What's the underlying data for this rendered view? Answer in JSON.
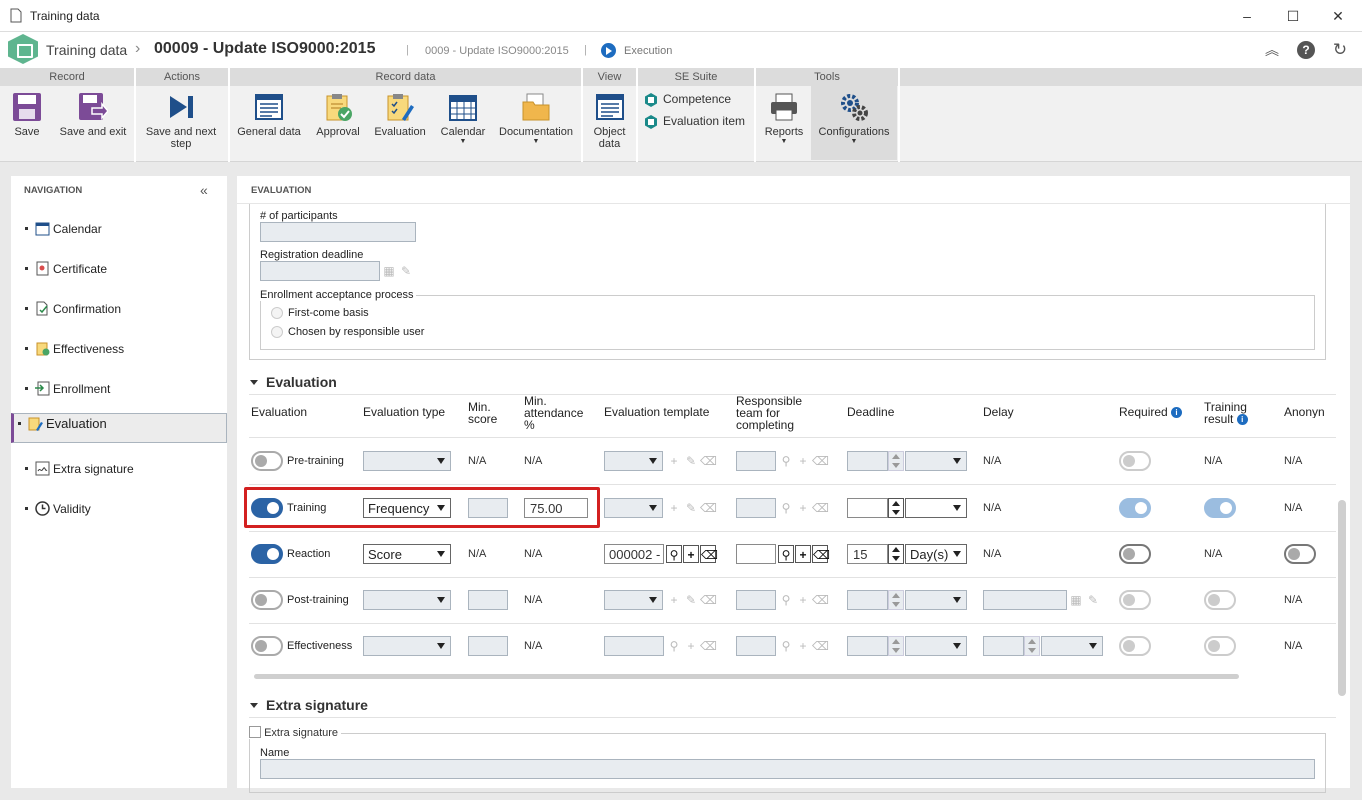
{
  "window": {
    "title": "Training data"
  },
  "header": {
    "breadcrumb_root": "Training data",
    "record_title": "00009 - Update ISO9000:2015",
    "record_subtitle": "0009 - Update ISO9000:2015",
    "status": "Execution"
  },
  "ribbon": {
    "groups": [
      "Record",
      "Actions",
      "Record data",
      "View",
      "SE Suite",
      "Tools"
    ],
    "buttons": {
      "save": "Save",
      "save_exit": "Save and exit",
      "save_next": "Save and next step",
      "general_data": "General data",
      "approval": "Approval",
      "evaluation": "Evaluation",
      "calendar": "Calendar",
      "documentation": "Documentation",
      "object_data": "Object data",
      "competence": "Competence",
      "evaluation_item": "Evaluation item",
      "reports": "Reports",
      "configurations": "Configurations"
    }
  },
  "navigation": {
    "title": "NAVIGATION",
    "items": [
      "Calendar",
      "Certificate",
      "Confirmation",
      "Effectiveness",
      "Enrollment",
      "Evaluation",
      "Extra signature",
      "Validity"
    ],
    "selected": "Evaluation"
  },
  "main": {
    "title": "EVALUATION",
    "participants_label": "# of participants",
    "registration_label": "Registration deadline",
    "enrollment_group": "Enrollment acceptance process",
    "enrollment_options": [
      "First-come basis",
      "Chosen by responsible user"
    ],
    "evaluation_section": "Evaluation",
    "table": {
      "headers": {
        "evaluation": "Evaluation",
        "type": "Evaluation type",
        "min_score": "Min. score",
        "min_attendance": "Min. attendance %",
        "template": "Evaluation template",
        "responsible": "Responsible team for completing",
        "deadline": "Deadline",
        "delay": "Delay",
        "required": "Required",
        "training_result": "Training result",
        "anonymous": "Anonyn"
      },
      "rows": [
        {
          "label": "Pre-training",
          "on": false,
          "type": "",
          "min_score": "N/A",
          "min_attendance": "N/A",
          "template": "",
          "deadline_num": "",
          "deadline_unit": "",
          "delay": "N/A",
          "required": false,
          "training_result": "N/A",
          "anonymous": "N/A"
        },
        {
          "label": "Training",
          "on": true,
          "type": "Frequency",
          "min_score": "",
          "min_attendance": "75.00",
          "template": "",
          "deadline_num": "",
          "deadline_unit": "",
          "delay": "N/A",
          "required": true,
          "training_result": "toggle-on",
          "anonymous": "N/A"
        },
        {
          "label": "Reaction",
          "on": true,
          "type": "Score",
          "min_score": "N/A",
          "min_attendance": "N/A",
          "template": "000002 -",
          "deadline_num": "15",
          "deadline_unit": "Day(s)",
          "delay": "N/A",
          "required": false,
          "training_result": "N/A",
          "anonymous": "toggle-off"
        },
        {
          "label": "Post-training",
          "on": false,
          "type": "",
          "min_score": "",
          "min_attendance": "N/A",
          "template": "",
          "deadline_num": "",
          "deadline_unit": "",
          "delay": "",
          "required": false,
          "training_result": "toggle-off",
          "anonymous": "N/A"
        },
        {
          "label": "Effectiveness",
          "on": false,
          "type": "",
          "min_score": "",
          "min_attendance": "N/A",
          "template": "",
          "deadline_num": "",
          "deadline_unit": "",
          "delay": "",
          "required": false,
          "training_result": "toggle-off",
          "anonymous": "N/A"
        }
      ]
    },
    "extra_section": "Extra signature",
    "extra_checkbox": "Extra signature",
    "name_label": "Name"
  },
  "colors": {
    "accent": "#2b63a5",
    "nav_selected": "#7c4b97",
    "highlight": "#d32020"
  }
}
